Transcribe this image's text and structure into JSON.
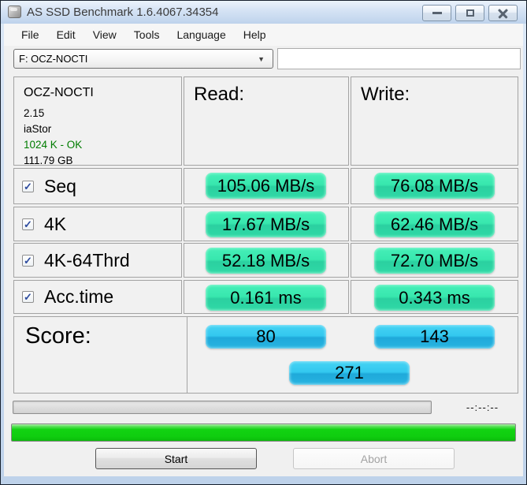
{
  "window": {
    "title": "AS SSD Benchmark 1.6.4067.34354"
  },
  "menu": {
    "items": [
      "File",
      "Edit",
      "View",
      "Tools",
      "Language",
      "Help"
    ]
  },
  "toolbar": {
    "drive_selector_value": "F: OCZ-NOCTI",
    "comment_value": ""
  },
  "drive_info": {
    "model": "OCZ-NOCTI",
    "firmware": "2.15",
    "driver": "iaStor",
    "alignment": "1024 K - OK",
    "capacity": "111.79 GB"
  },
  "table": {
    "read_header": "Read:",
    "write_header": "Write:",
    "tests": [
      {
        "label": "Seq",
        "checked": true,
        "read": "105.06 MB/s",
        "write": "76.08 MB/s"
      },
      {
        "label": "4K",
        "checked": true,
        "read": "17.67 MB/s",
        "write": "62.46 MB/s"
      },
      {
        "label": "4K-64Thrd",
        "checked": true,
        "read": "52.18 MB/s",
        "write": "72.70 MB/s"
      },
      {
        "label": "Acc.time",
        "checked": true,
        "read": "0.161 ms",
        "write": "0.343 ms"
      }
    ]
  },
  "score": {
    "label": "Score:",
    "read": "80",
    "write": "143",
    "total": "271"
  },
  "status": {
    "time_remaining": "--:--:--",
    "overall_progress_percent": 100
  },
  "actions": {
    "start": "Start",
    "abort": "Abort"
  },
  "glyphs": {
    "check": "✓",
    "dropdown_arrow": "▼"
  },
  "colors": {
    "pill_green": "#31dfa8",
    "pill_blue": "#2bbfe8",
    "progress_green": "#12d312",
    "alignment_ok_text": "#007c00",
    "titlebar_blue": "#c9daef"
  }
}
